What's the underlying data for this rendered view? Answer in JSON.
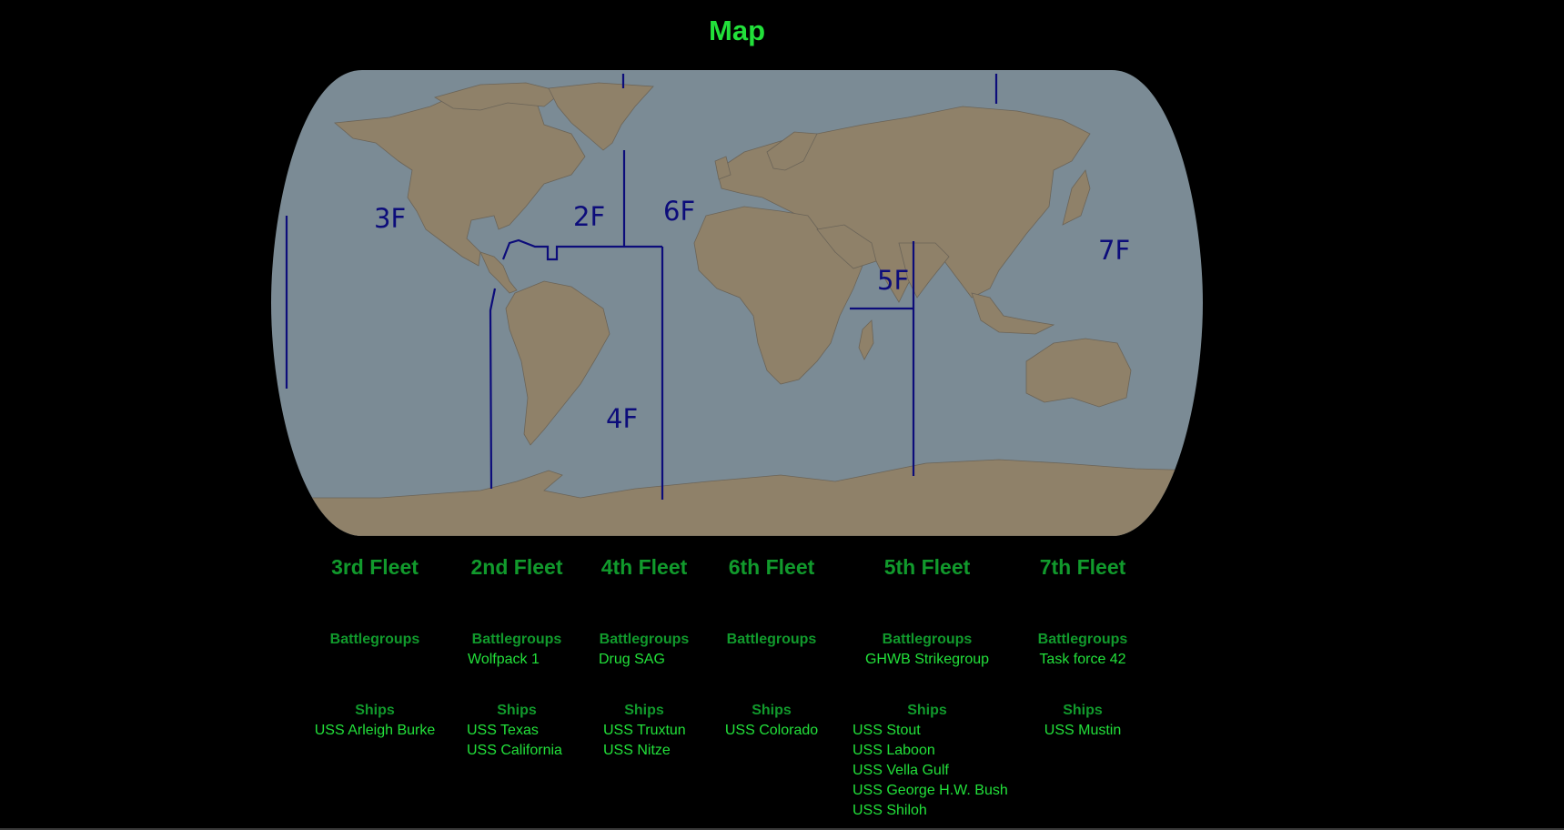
{
  "page": {
    "title": "Map"
  },
  "colors": {
    "background": "#000000",
    "title": "#22e03a",
    "heading": "#119a2c",
    "item_text": "#22e03a",
    "ocean": "#7b8b95",
    "land": "#8f8169",
    "land_border": "#6b6458",
    "boundary": "#0c0c7a"
  },
  "map": {
    "zone_labels": [
      "3F",
      "2F",
      "6F",
      "4F",
      "5F",
      "7F"
    ]
  },
  "fleets": [
    {
      "name": "3rd Fleet",
      "battlegroups_label": "Battlegroups",
      "battlegroups": [],
      "ships_label": "Ships",
      "ships": [
        "USS Arleigh Burke"
      ]
    },
    {
      "name": "2nd Fleet",
      "battlegroups_label": "Battlegroups",
      "battlegroups": [
        "Wolfpack 1"
      ],
      "ships_label": "Ships",
      "ships": [
        "USS Texas",
        "USS California"
      ]
    },
    {
      "name": "4th Fleet",
      "battlegroups_label": "Battlegroups",
      "battlegroups": [
        "Drug SAG"
      ],
      "ships_label": "Ships",
      "ships": [
        "USS Truxtun",
        "USS Nitze"
      ]
    },
    {
      "name": "6th Fleet",
      "battlegroups_label": "Battlegroups",
      "battlegroups": [],
      "ships_label": "Ships",
      "ships": [
        "USS Colorado"
      ]
    },
    {
      "name": "5th Fleet",
      "battlegroups_label": "Battlegroups",
      "battlegroups": [
        "GHWB Strikegroup"
      ],
      "ships_label": "Ships",
      "ships": [
        "USS Stout",
        "USS Laboon",
        "USS Vella Gulf",
        "USS George H.W. Bush",
        "USS Shiloh"
      ]
    },
    {
      "name": "7th Fleet",
      "battlegroups_label": "Battlegroups",
      "battlegroups": [
        "Task force 42"
      ],
      "ships_label": "Ships",
      "ships": [
        "USS Mustin"
      ]
    }
  ]
}
